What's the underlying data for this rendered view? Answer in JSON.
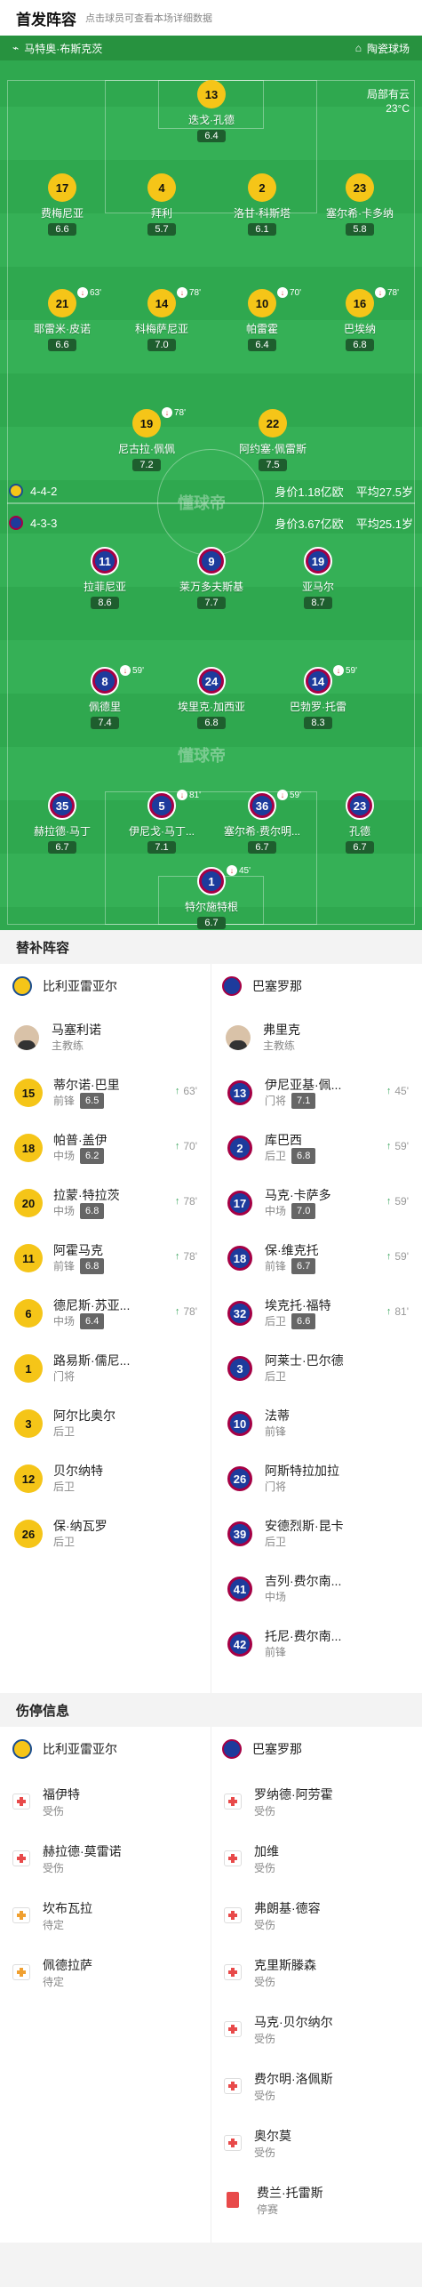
{
  "header": {
    "title": "首发阵容",
    "subtitle": "点击球员可查看本场详细数据"
  },
  "pitch": {
    "venue": "马特奥·布斯克茨",
    "referee": "陶瓷球场",
    "weather": "局部有云",
    "temp": "23°C",
    "home_info": {
      "formation": "4-4-2",
      "value": "身价1.18亿欧",
      "age": "平均27.5岁"
    },
    "away_info": {
      "formation": "4-3-3",
      "value": "身价3.67亿欧",
      "age": "平均25.1岁"
    },
    "home_players": [
      {
        "num": "13",
        "name": "迭戈·孔德",
        "rating": "6.4"
      },
      {
        "num": "17",
        "name": "费梅尼亚",
        "rating": "6.6"
      },
      {
        "num": "4",
        "name": "拜利",
        "rating": "5.7"
      },
      {
        "num": "2",
        "name": "洛甘·科斯塔",
        "rating": "6.1"
      },
      {
        "num": "23",
        "name": "塞尔希·卡多纳",
        "rating": "5.8"
      },
      {
        "num": "21",
        "name": "耶雷米·皮诺",
        "rating": "6.6",
        "sub": "63'"
      },
      {
        "num": "14",
        "name": "科梅萨尼亚",
        "rating": "7.0",
        "sub": "78'"
      },
      {
        "num": "10",
        "name": "帕雷霍",
        "rating": "6.4",
        "sub": "70'"
      },
      {
        "num": "16",
        "name": "巴埃纳",
        "rating": "6.8",
        "sub": "78'"
      },
      {
        "num": "19",
        "name": "尼古拉·佩佩",
        "rating": "7.2",
        "sub": "78'"
      },
      {
        "num": "22",
        "name": "阿约塞·佩雷斯",
        "rating": "7.5"
      }
    ],
    "away_players": [
      {
        "num": "11",
        "name": "拉菲尼亚",
        "rating": "8.6"
      },
      {
        "num": "9",
        "name": "莱万多夫斯基",
        "rating": "7.7"
      },
      {
        "num": "19",
        "name": "亚马尔",
        "rating": "8.7"
      },
      {
        "num": "8",
        "name": "佩德里",
        "rating": "7.4",
        "sub": "59'"
      },
      {
        "num": "24",
        "name": "埃里克·加西亚",
        "rating": "6.8"
      },
      {
        "num": "14",
        "name": "巴勃罗·托雷",
        "rating": "8.3",
        "sub": "59'"
      },
      {
        "num": "35",
        "name": "赫拉德·马丁",
        "rating": "6.7"
      },
      {
        "num": "5",
        "name": "伊尼戈·马丁...",
        "rating": "7.1",
        "sub": "81'"
      },
      {
        "num": "36",
        "name": "塞尔希·费尔明...",
        "rating": "6.7",
        "sub": "59'"
      },
      {
        "num": "23",
        "name": "孔德",
        "rating": "6.7"
      },
      {
        "num": "1",
        "name": "特尔施特根",
        "rating": "6.7",
        "sub": "45'"
      }
    ]
  },
  "subs": {
    "title": "替补阵容",
    "home_team": "比利亚雷亚尔",
    "away_team": "巴塞罗那",
    "home_coach": {
      "name": "马塞利诺",
      "role": "主教练"
    },
    "away_coach": {
      "name": "弗里克",
      "role": "主教练"
    },
    "home": [
      {
        "num": "15",
        "name": "蒂尔诺·巴里",
        "pos": "前锋",
        "rating": "6.5",
        "time": "63'"
      },
      {
        "num": "18",
        "name": "帕普·盖伊",
        "pos": "中场",
        "rating": "6.2",
        "time": "70'"
      },
      {
        "num": "20",
        "name": "拉蒙·特拉茨",
        "pos": "中场",
        "rating": "6.8",
        "time": "78'"
      },
      {
        "num": "11",
        "name": "阿霍马克",
        "pos": "前锋",
        "rating": "6.8",
        "time": "78'"
      },
      {
        "num": "6",
        "name": "德尼斯·苏亚...",
        "pos": "中场",
        "rating": "6.4",
        "time": "78'"
      },
      {
        "num": "1",
        "name": "路易斯·儒尼...",
        "pos": "门将"
      },
      {
        "num": "3",
        "name": "阿尔比奥尔",
        "pos": "后卫"
      },
      {
        "num": "12",
        "name": "贝尔纳特",
        "pos": "后卫"
      },
      {
        "num": "26",
        "name": "保·纳瓦罗",
        "pos": "后卫"
      }
    ],
    "away": [
      {
        "num": "13",
        "name": "伊尼亚基·佩...",
        "pos": "门将",
        "rating": "7.1",
        "time": "45'"
      },
      {
        "num": "2",
        "name": "库巴西",
        "pos": "后卫",
        "rating": "6.8",
        "time": "59'"
      },
      {
        "num": "17",
        "name": "马克·卡萨多",
        "pos": "中场",
        "rating": "7.0",
        "time": "59'"
      },
      {
        "num": "18",
        "name": "保·维克托",
        "pos": "前锋",
        "rating": "6.7",
        "time": "59'"
      },
      {
        "num": "32",
        "name": "埃克托·福特",
        "pos": "后卫",
        "rating": "6.6",
        "time": "81'"
      },
      {
        "num": "3",
        "name": "阿莱士·巴尔德",
        "pos": "后卫"
      },
      {
        "num": "10",
        "name": "法蒂",
        "pos": "前锋"
      },
      {
        "num": "26",
        "name": "阿斯特拉加拉",
        "pos": "门将"
      },
      {
        "num": "39",
        "name": "安德烈斯·昆卡",
        "pos": "后卫"
      },
      {
        "num": "41",
        "name": "吉列·费尔南...",
        "pos": "中场"
      },
      {
        "num": "42",
        "name": "托尼·费尔南...",
        "pos": "前锋"
      }
    ]
  },
  "injuries": {
    "title": "伤停信息",
    "home_team": "比利亚雷亚尔",
    "away_team": "巴塞罗那",
    "home": [
      {
        "name": "福伊特",
        "status": "受伤"
      },
      {
        "name": "赫拉德·莫雷诺",
        "status": "受伤"
      },
      {
        "name": "坎布瓦拉",
        "status": "待定"
      },
      {
        "name": "佩德拉萨",
        "status": "待定"
      }
    ],
    "away": [
      {
        "name": "罗纳德·阿劳霍",
        "status": "受伤"
      },
      {
        "name": "加维",
        "status": "受伤"
      },
      {
        "name": "弗朗基·德容",
        "status": "受伤"
      },
      {
        "name": "克里斯滕森",
        "status": "受伤"
      },
      {
        "name": "马克·贝尔纳尔",
        "status": "受伤"
      },
      {
        "name": "费尔明·洛佩斯",
        "status": "受伤"
      },
      {
        "name": "奥尔莫",
        "status": "受伤"
      },
      {
        "name": "费兰·托雷斯",
        "status": "停赛"
      }
    ]
  }
}
